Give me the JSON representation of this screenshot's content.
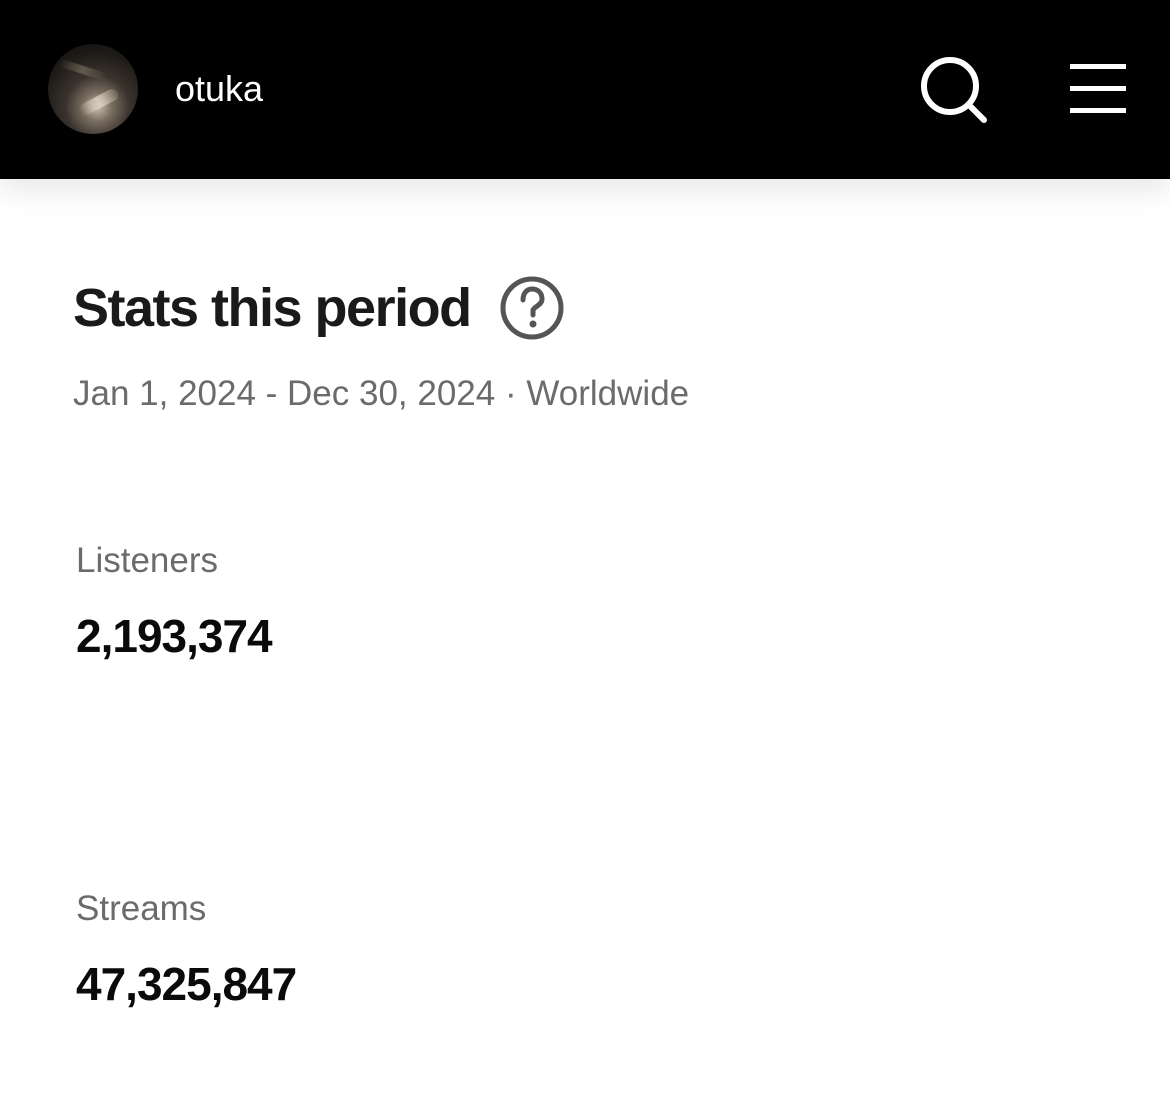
{
  "header": {
    "username": "otuka",
    "avatar_icon": "user-avatar",
    "search_icon": "search-icon",
    "menu_icon": "hamburger-menu-icon",
    "background": "#000000"
  },
  "stats": {
    "title": "Stats this period",
    "help_icon": "question-circle-icon",
    "date_range": "Jan 1, 2024 - Dec 30, 2024",
    "separator": "·",
    "region": "Worldwide",
    "items": [
      {
        "label": "Listeners",
        "value": "2,193,374"
      },
      {
        "label": "Streams",
        "value": "47,325,847"
      }
    ]
  }
}
